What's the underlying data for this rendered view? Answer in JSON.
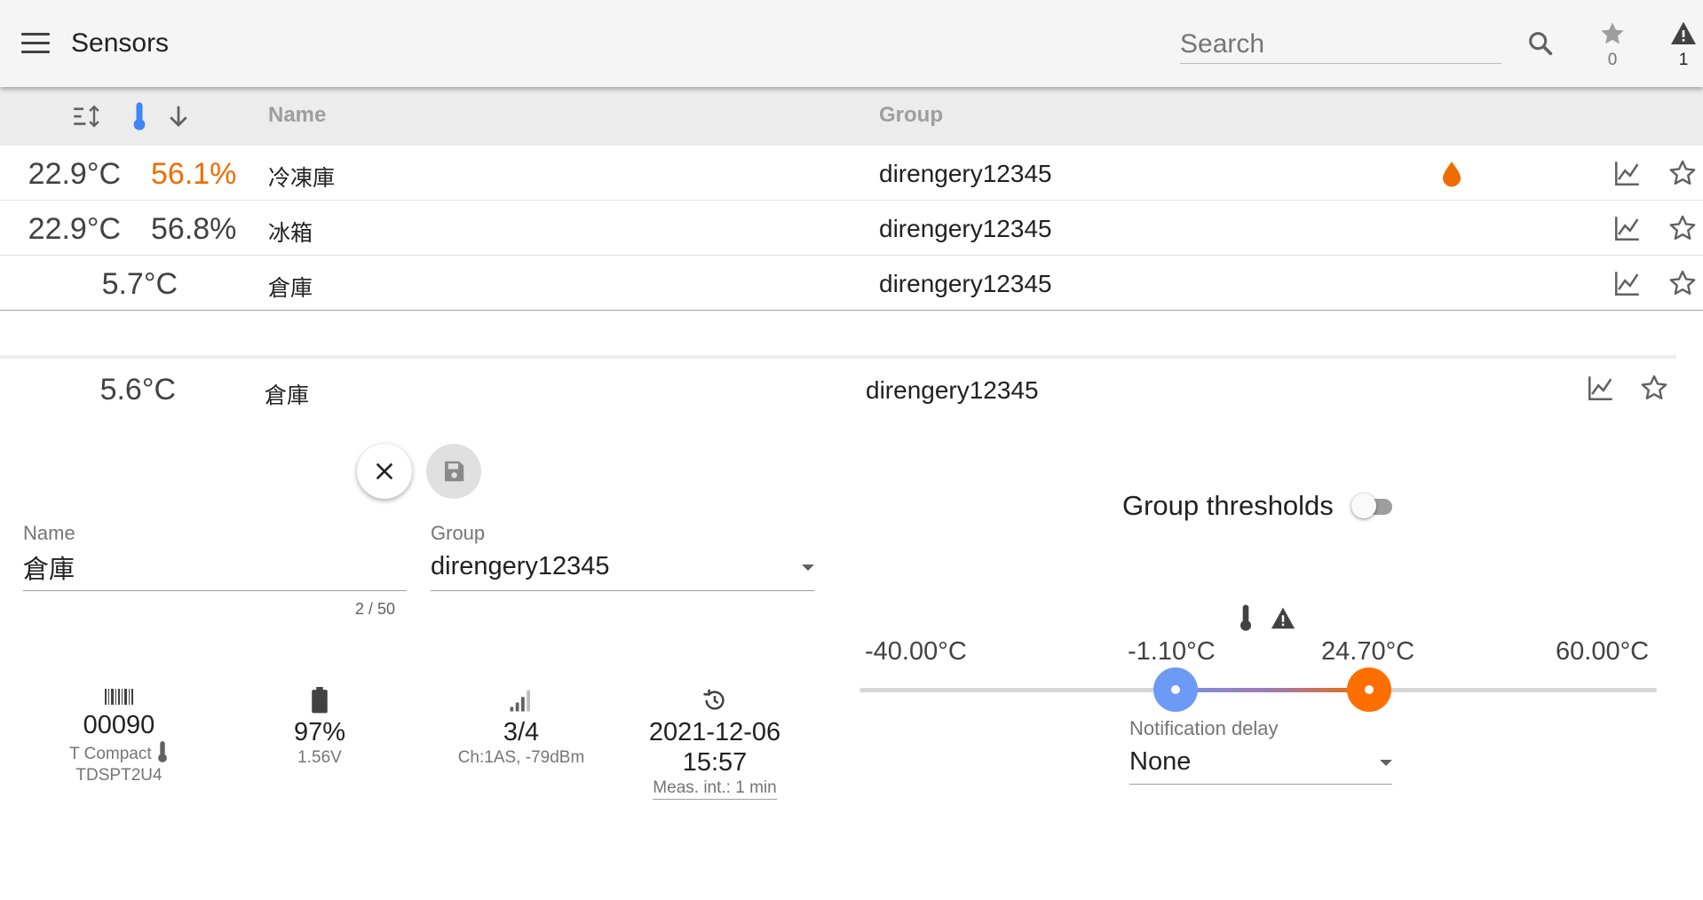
{
  "app": {
    "title": "Sensors",
    "search_placeholder": "Search",
    "favorites_count": "0",
    "alarms_count": "1"
  },
  "table": {
    "headers": {
      "name": "Name",
      "group": "Group"
    },
    "rows": [
      {
        "temp": "22.9°C",
        "humidity": "56.1%",
        "humidity_alert": true,
        "name": "冷凍庫",
        "group": "direngery12345",
        "water_alert": true
      },
      {
        "temp": "22.9°C",
        "humidity": "56.8%",
        "humidity_alert": false,
        "name": "冰箱",
        "group": "direngery12345",
        "water_alert": false
      },
      {
        "temp": "5.7°C",
        "humidity": "",
        "humidity_alert": false,
        "name": "倉庫",
        "group": "direngery12345",
        "water_alert": false
      }
    ]
  },
  "detail": {
    "temp": "5.6°C",
    "name": "倉庫",
    "group": "direngery12345",
    "form": {
      "name_label": "Name",
      "name_value": "倉庫",
      "name_counter": "2 / 50",
      "group_label": "Group",
      "group_value": "direngery12345"
    },
    "info": {
      "serial": "00090",
      "model": "T Compact",
      "model_code": "TDSPT2U4",
      "battery_percent": "97%",
      "battery_voltage": "1.56V",
      "signal": "3/4",
      "signal_detail": "Ch:1AS, -79dBm",
      "last_date": "2021-12-06",
      "last_time": "15:57",
      "meas_interval": "Meas. int.: 1 min"
    },
    "thresholds": {
      "group_thresholds_label": "Group thresholds",
      "group_thresholds_enabled": false,
      "min_label": "-40.00°C",
      "max_label": "60.00°C",
      "low_label": "-1.10°C",
      "high_label": "24.70°C",
      "range_min": -40,
      "range_max": 60,
      "low": -1.1,
      "high": 24.7
    },
    "notification_delay": {
      "label": "Notification delay",
      "value": "None"
    }
  },
  "colors": {
    "accent_blue": "#6c9af5",
    "accent_orange": "#ff6f00",
    "humidity_warning": "#ef6c00"
  }
}
